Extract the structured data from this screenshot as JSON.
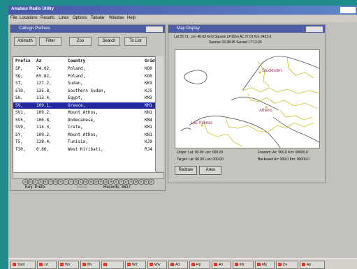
{
  "app": {
    "title": "Amateur Radio Utility"
  },
  "menus": [
    "File",
    "Locations",
    "Results",
    "Lines",
    "Options",
    "Tabular",
    "Window",
    "Help"
  ],
  "callsign_window": {
    "title": "Callsign Prefixes",
    "toolbar": [
      "Azimuth",
      "Filter",
      "Zoo",
      "Search",
      "To List"
    ],
    "columns": [
      "Prefix",
      "Az",
      "Country",
      "Grid"
    ],
    "rows": [
      {
        "prefix": "SP,",
        "az": "74.02,",
        "country": "Poland,",
        "grid": "KO0"
      },
      {
        "prefix": "SQ,",
        "az": "65.82,",
        "country": "Poland,",
        "grid": "KO0"
      },
      {
        "prefix": "ST,",
        "az": "127.2,",
        "country": "Sudan,",
        "grid": "KK9"
      },
      {
        "prefix": "STO,",
        "az": "135.8,",
        "country": "Southern Sudan,",
        "grid": "KJ5"
      },
      {
        "prefix": "SU,",
        "az": "113.4,",
        "country": "Egypt,",
        "grid": "KM3"
      },
      {
        "prefix": "SV,",
        "az": "109.1,",
        "country": "Greece,",
        "grid": "KM1"
      },
      {
        "prefix": "SV1,",
        "az": "109.2,",
        "country": "Mount Athos,",
        "grid": "KN1"
      },
      {
        "prefix": "SV5,",
        "az": "106.8,",
        "country": "Dodecanese,",
        "grid": "KM4"
      },
      {
        "prefix": "SV9,",
        "az": "114.3,",
        "country": "Crete,",
        "grid": "KM1"
      },
      {
        "prefix": "SY,",
        "az": "109.2,",
        "country": "Mount Athos,",
        "grid": "KN1"
      },
      {
        "prefix": "T5,",
        "az": "138.4,",
        "country": "Tunisia,",
        "grid": "KJ9"
      },
      {
        "prefix": "T30,",
        "az": "6.66,",
        "country": "West Kiribati,",
        "grid": "RJ4"
      }
    ],
    "selected_index": 5,
    "letters": [
      "A",
      "B",
      "C",
      "D",
      "E",
      "F",
      "G",
      "H",
      "I",
      "J",
      "K",
      "L",
      "M",
      "N",
      "O",
      "P",
      "Q",
      "R",
      "S",
      "T",
      "U",
      "V",
      "W",
      "X",
      "Y",
      "Z"
    ],
    "status": {
      "mode": "Key: Prefix",
      "state": "Menu",
      "records": "Records: 3617"
    }
  },
  "map_window": {
    "title": "Map Display",
    "info_line1": "Lat 55.71, Lon 46.03    Grid Square LP15hn    Az 37.01 Km 2423.6",
    "info_line2": "Sunrise 03:38:45  Sunset 17:13:36",
    "cities": [
      "Stockholm",
      "Athens",
      "Las Palmas"
    ],
    "origin_line": "Origin: Lat: 00.00 Lon: 000.00",
    "forward_line": "Forward: Az: 000.0  Km: 00000.0",
    "target_line": "Target: Lat: 00.00 Lon: 000.00",
    "backward_line": "Backward Az: 000.0  Km: 00000.0",
    "buttons": [
      "Redraw",
      "Area"
    ],
    "colors": {
      "border": "#d2c63a",
      "coast": "#4e4e4e",
      "water": "#ffffff",
      "cities": "#9f2a6a"
    }
  },
  "taskbar": {
    "items": [
      "Start",
      "1d",
      "Wo",
      "Ms",
      "",
      "Wd",
      "Ww",
      "Ad",
      "Rp",
      "Ao",
      "Ms",
      "Mp",
      "Ds",
      "Ap"
    ]
  }
}
